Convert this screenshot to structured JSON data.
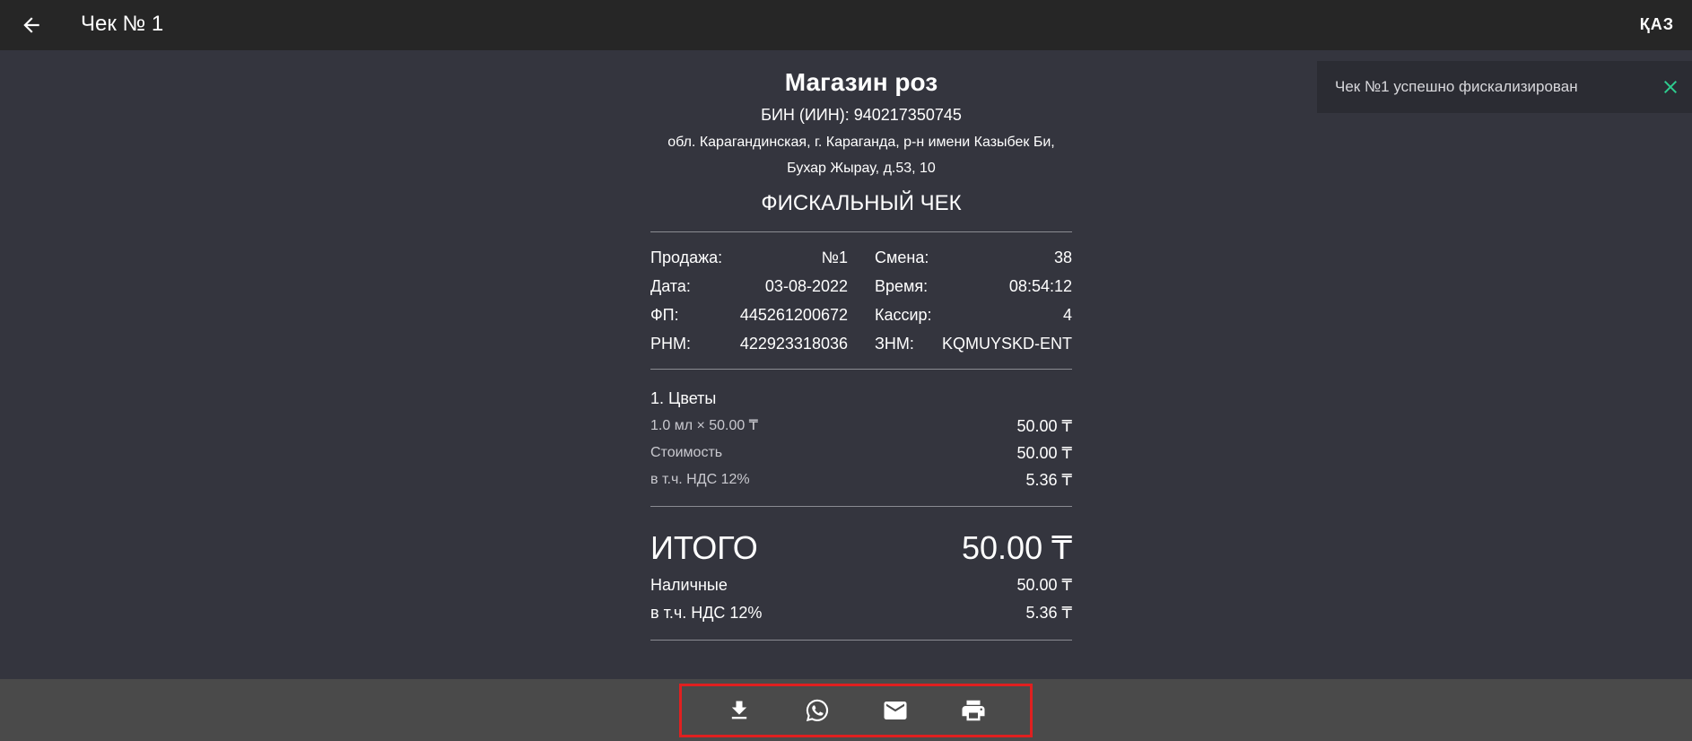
{
  "header": {
    "title": "Чек № 1",
    "lang": "ҚАЗ"
  },
  "toast": {
    "message": "Чек №1 успешно фискализирован"
  },
  "receipt": {
    "shop_name": "Магазин роз",
    "bin": "БИН (ИИН): 940217350745",
    "address_line1": "обл. Карагандинская, г. Караганда, р-н имени Казыбек Би,",
    "address_line2": "Бухар Жырау, д.53, 10",
    "fiscal_title": "ФИСКАЛЬНЫЙ ЧЕК",
    "info": {
      "left": [
        {
          "label": "Продажа:",
          "value": "№1"
        },
        {
          "label": "Дата:",
          "value": "03-08-2022"
        },
        {
          "label": "ФП:",
          "value": "445261200672"
        },
        {
          "label": "РНМ:",
          "value": "422923318036"
        }
      ],
      "right": [
        {
          "label": "Смена:",
          "value": "38"
        },
        {
          "label": "Время:",
          "value": "08:54:12"
        },
        {
          "label": "Кассир:",
          "value": "4"
        },
        {
          "label": "ЗНМ:",
          "value": "KQMUYSKD-ENT"
        }
      ]
    },
    "item": {
      "title": "1. Цветы",
      "qty_price_label": "1.0 мл × 50.00 ₸",
      "qty_price_value": "50.00 ₸",
      "cost_label": "Стоимость",
      "cost_value": "50.00 ₸",
      "vat_label": "в т.ч. НДС 12%",
      "vat_value": "5.36 ₸"
    },
    "total": {
      "label": "ИТОГО",
      "value": "50.00 ₸"
    },
    "payment": {
      "cash_label": "Наличные",
      "cash_value": "50.00 ₸",
      "vat_label": "в т.ч. НДС 12%",
      "vat_value": "5.36 ₸"
    }
  },
  "colors": {
    "background": "#34353e",
    "topbar": "#262626",
    "bottombar": "#4a4a4a",
    "toast_close": "#2ecc8f",
    "highlight_border": "#e02020"
  },
  "icons": {
    "back": "arrow-left-icon",
    "close": "close-icon",
    "download": "download-icon",
    "whatsapp": "whatsapp-icon",
    "email": "email-icon",
    "print": "printer-icon"
  }
}
